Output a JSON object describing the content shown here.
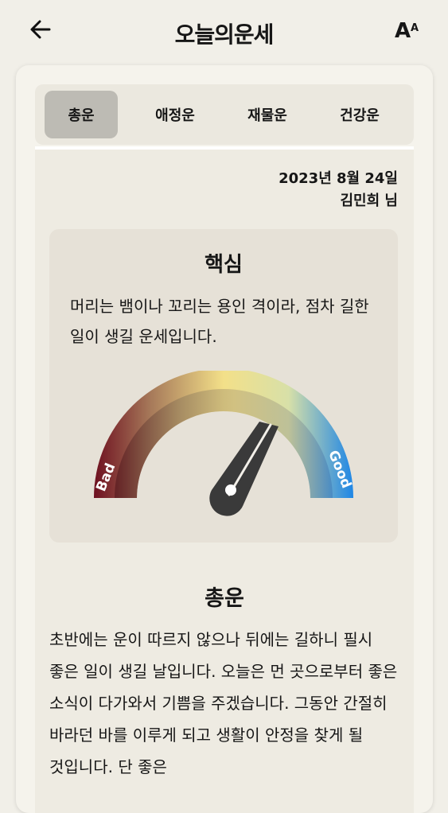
{
  "header": {
    "title": "오늘의운세",
    "font_size_big": "A",
    "font_size_small": "A"
  },
  "tabs": [
    {
      "label": "총운",
      "active": true
    },
    {
      "label": "애정운",
      "active": false
    },
    {
      "label": "재물운",
      "active": false
    },
    {
      "label": "건강운",
      "active": false
    }
  ],
  "info": {
    "date": "2023년 8월 24일",
    "name": "김민희 님"
  },
  "core": {
    "title": "핵심",
    "text": "머리는 뱀이나 꼬리는 용인 격이라, 점차 길한 일이 생길 운세입니다.",
    "gauge_bad_label": "Bad",
    "gauge_good_label": "Good",
    "gauge_level": 0.7
  },
  "section": {
    "title": "총운",
    "text": "초반에는 운이 따르지 않으나 뒤에는 길하니 필시 좋은 일이 생길 날입니다. 오늘은 먼 곳으로부터 좋은 소식이 다가와서 기쁨을 주겠습니다. 그동안 간절히 바라던 바를 이루게 되고 생활이 안정을 찾게 될 것입니다. 단 좋은"
  },
  "colors": {
    "background": "#f1efe8",
    "tab_active": "#bdbbb4",
    "gauge_needle": "#3a3a3a"
  }
}
